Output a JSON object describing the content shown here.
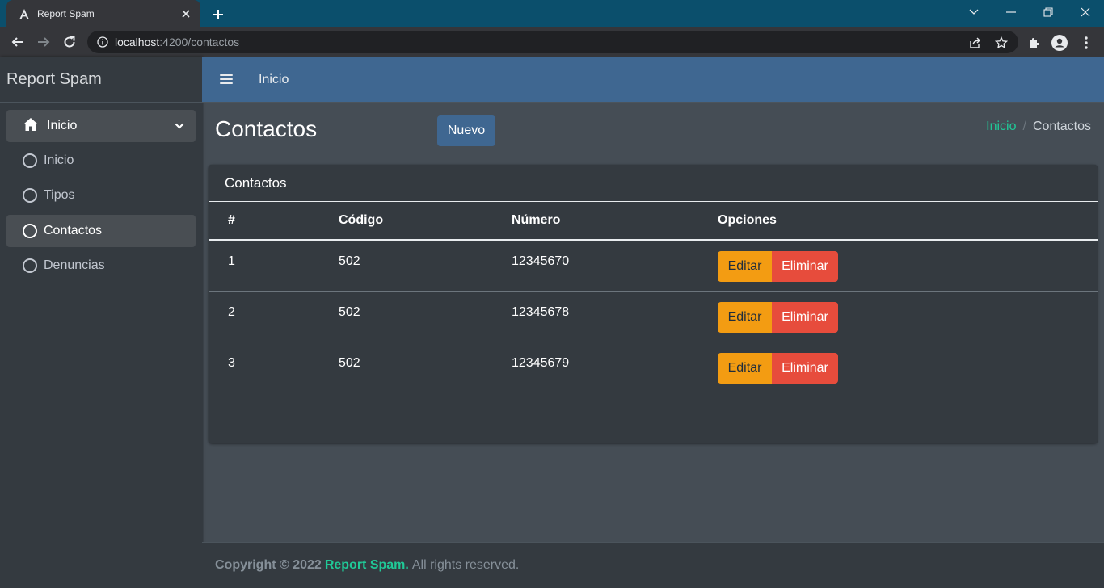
{
  "browser": {
    "tab_title": "Report Spam",
    "url_host": "localhost",
    "url_path": ":4200/contactos",
    "icons": [
      "angular-icon",
      "close-icon",
      "plus-icon",
      "chevron-down-icon",
      "minimize-icon",
      "restore-icon",
      "close-window-icon",
      "back-arrow-icon",
      "forward-arrow-icon",
      "reload-icon",
      "info-icon",
      "share-icon",
      "star-icon",
      "extensions-icon",
      "profile-icon",
      "kebab-menu-icon"
    ]
  },
  "sidebar": {
    "brand": "Report Spam",
    "parent": {
      "label": "Inicio",
      "icon": "home-icon"
    },
    "items": [
      {
        "label": "Inicio",
        "active": false
      },
      {
        "label": "Tipos",
        "active": false
      },
      {
        "label": "Contactos",
        "active": true
      },
      {
        "label": "Denuncias",
        "active": false
      }
    ]
  },
  "topnav": {
    "link": "Inicio"
  },
  "header": {
    "title": "Contactos",
    "new_button": "Nuevo",
    "breadcrumb": {
      "link": "Inicio",
      "separator": "/",
      "current": "Contactos"
    }
  },
  "card": {
    "title": "Contactos",
    "columns": [
      "#",
      "Código",
      "Número",
      "Opciones"
    ],
    "rows": [
      {
        "id": "1",
        "codigo": "502",
        "numero": "12345670"
      },
      {
        "id": "2",
        "codigo": "502",
        "numero": "12345678"
      },
      {
        "id": "3",
        "codigo": "502",
        "numero": "12345679"
      }
    ],
    "edit_label": "Editar",
    "delete_label": "Eliminar"
  },
  "footer": {
    "copyright": "Copyright © 2022",
    "brand": "Report Spam.",
    "rights": "All rights reserved."
  },
  "colors": {
    "tabbar": "#0b4f6c",
    "navbar": "#3f6791",
    "sidebar": "#343a40",
    "content": "#454d55",
    "accent_teal": "#20c997",
    "warning": "#f39c12",
    "danger": "#e74c3c"
  }
}
